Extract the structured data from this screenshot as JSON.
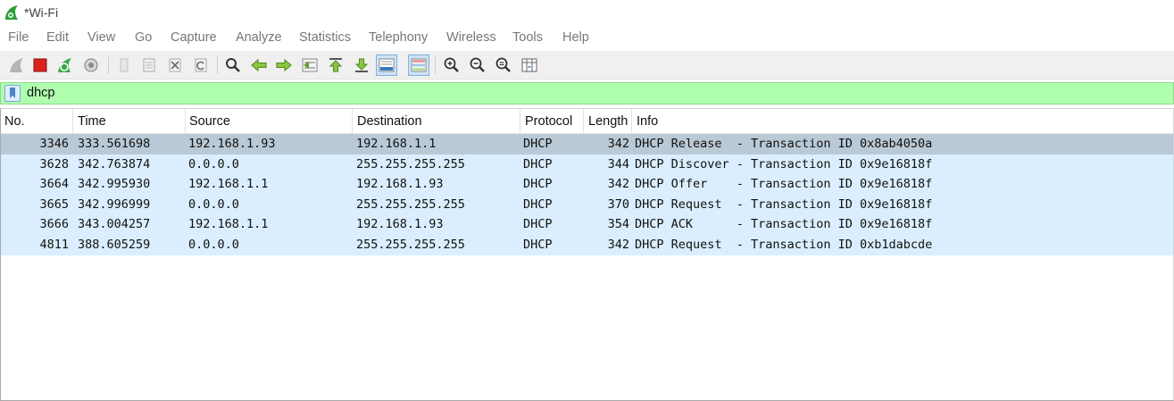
{
  "window": {
    "title": "*Wi-Fi"
  },
  "menu": [
    "File",
    "Edit",
    "View",
    "Go",
    "Capture",
    "Analyze",
    "Statistics",
    "Telephony",
    "Wireless",
    "Tools",
    "Help"
  ],
  "toolbar": {
    "icons": [
      "shark-fin-start-icon",
      "stop-capture-icon",
      "restart-capture-icon",
      "capture-options-icon",
      "open-file-icon",
      "save-file-icon",
      "close-file-icon",
      "reload-file-icon",
      "find-packet-icon",
      "go-back-icon",
      "go-forward-icon",
      "go-to-packet-icon",
      "go-to-first-packet-icon",
      "go-to-last-packet-icon",
      "auto-scroll-icon",
      "colorize-icon",
      "zoom-in-icon",
      "zoom-out-icon",
      "normal-size-icon",
      "resize-columns-icon"
    ]
  },
  "filter": {
    "value": "dhcp"
  },
  "packet_list": {
    "columns": [
      "No.",
      "Time",
      "Source",
      "Destination",
      "Protocol",
      "Length",
      "Info"
    ],
    "rows": [
      {
        "no": "3346",
        "time": "333.561698",
        "source": "192.168.1.93",
        "destination": "192.168.1.1",
        "protocol": "DHCP",
        "length": "342",
        "info": "DHCP Release  - Transaction ID 0x8ab4050a"
      },
      {
        "no": "3628",
        "time": "342.763874",
        "source": "0.0.0.0",
        "destination": "255.255.255.255",
        "protocol": "DHCP",
        "length": "344",
        "info": "DHCP Discover - Transaction ID 0x9e16818f"
      },
      {
        "no": "3664",
        "time": "342.995930",
        "source": "192.168.1.1",
        "destination": "192.168.1.93",
        "protocol": "DHCP",
        "length": "342",
        "info": "DHCP Offer    - Transaction ID 0x9e16818f"
      },
      {
        "no": "3665",
        "time": "342.996999",
        "source": "0.0.0.0",
        "destination": "255.255.255.255",
        "protocol": "DHCP",
        "length": "370",
        "info": "DHCP Request  - Transaction ID 0x9e16818f"
      },
      {
        "no": "3666",
        "time": "343.004257",
        "source": "192.168.1.1",
        "destination": "192.168.1.93",
        "protocol": "DHCP",
        "length": "354",
        "info": "DHCP ACK      - Transaction ID 0x9e16818f"
      },
      {
        "no": "4811",
        "time": "388.605259",
        "source": "0.0.0.0",
        "destination": "255.255.255.255",
        "protocol": "DHCP",
        "length": "342",
        "info": "DHCP Request  - Transaction ID 0xb1dabcde"
      }
    ]
  },
  "colors": {
    "filter_valid": "#afffaf",
    "row_background": "#daeeff",
    "row_selected": "#b9c9d6"
  }
}
